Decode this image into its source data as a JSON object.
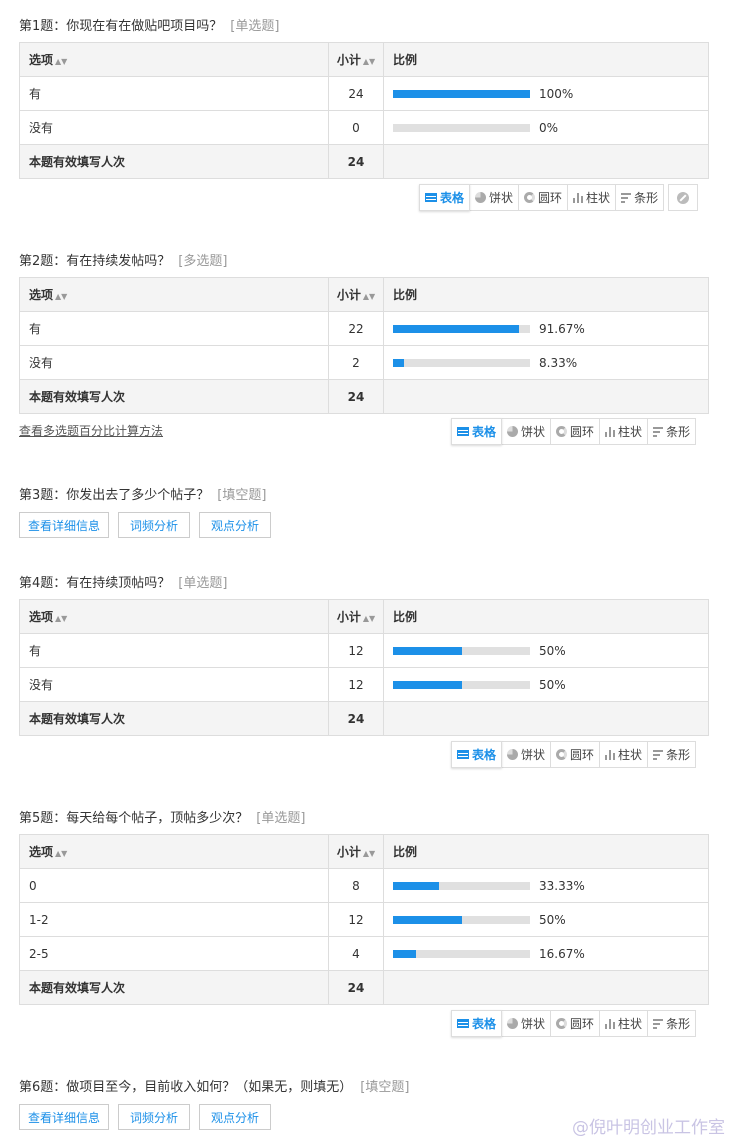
{
  "labels": {
    "option_col": "选项",
    "count_col": "小计",
    "ratio_col": "比例",
    "total_label": "本题有效填写人次",
    "sort_icon": "sort-icon"
  },
  "toolbar": {
    "table": "表格",
    "pie": "饼状",
    "ring": "圆环",
    "column": "柱状",
    "bar": "条形"
  },
  "buttons": {
    "detail": "查看详细信息",
    "word_freq": "词频分析",
    "opinion": "观点分析"
  },
  "calc_link": "查看多选题百分比计算方法",
  "watermark": "@倪叶明创业工作室",
  "colors": {
    "bar_fill": "#1c90e8",
    "bar_track": "#e0e0e0",
    "header_bg": "#f4f4f4"
  },
  "questions": [
    {
      "title": "第1题：你现在有在做贴吧项目吗？",
      "type": "[单选题]",
      "rows": [
        {
          "option": "有",
          "count": "24",
          "pct": "100%",
          "fraction": 1.0
        },
        {
          "option": "没有",
          "count": "0",
          "pct": "0%",
          "fraction": 0
        }
      ],
      "total": "24"
    },
    {
      "title": "第2题：有在持续发帖吗？",
      "type": "[多选题]",
      "rows": [
        {
          "option": "有",
          "count": "22",
          "pct": "91.67%",
          "fraction": 0.9167
        },
        {
          "option": "没有",
          "count": "2",
          "pct": "8.33%",
          "fraction": 0.0833
        }
      ],
      "total": "24"
    },
    {
      "title": "第3题：你发出去了多少个帖子？",
      "type": "[填空题]"
    },
    {
      "title": "第4题：有在持续顶帖吗？",
      "type": "[单选题]",
      "rows": [
        {
          "option": "有",
          "count": "12",
          "pct": "50%",
          "fraction": 0.5
        },
        {
          "option": "没有",
          "count": "12",
          "pct": "50%",
          "fraction": 0.5
        }
      ],
      "total": "24"
    },
    {
      "title": "第5题：每天给每个帖子，顶帖多少次？",
      "type": "[单选题]",
      "rows": [
        {
          "option": "0",
          "count": "8",
          "pct": "33.33%",
          "fraction": 0.3333
        },
        {
          "option": "1-2",
          "count": "12",
          "pct": "50%",
          "fraction": 0.5
        },
        {
          "option": "2-5",
          "count": "4",
          "pct": "16.67%",
          "fraction": 0.1667
        }
      ],
      "total": "24"
    },
    {
      "title": "第6题：做项目至今，目前收入如何？（如果无，则填无）",
      "type": "[填空题]"
    }
  ]
}
